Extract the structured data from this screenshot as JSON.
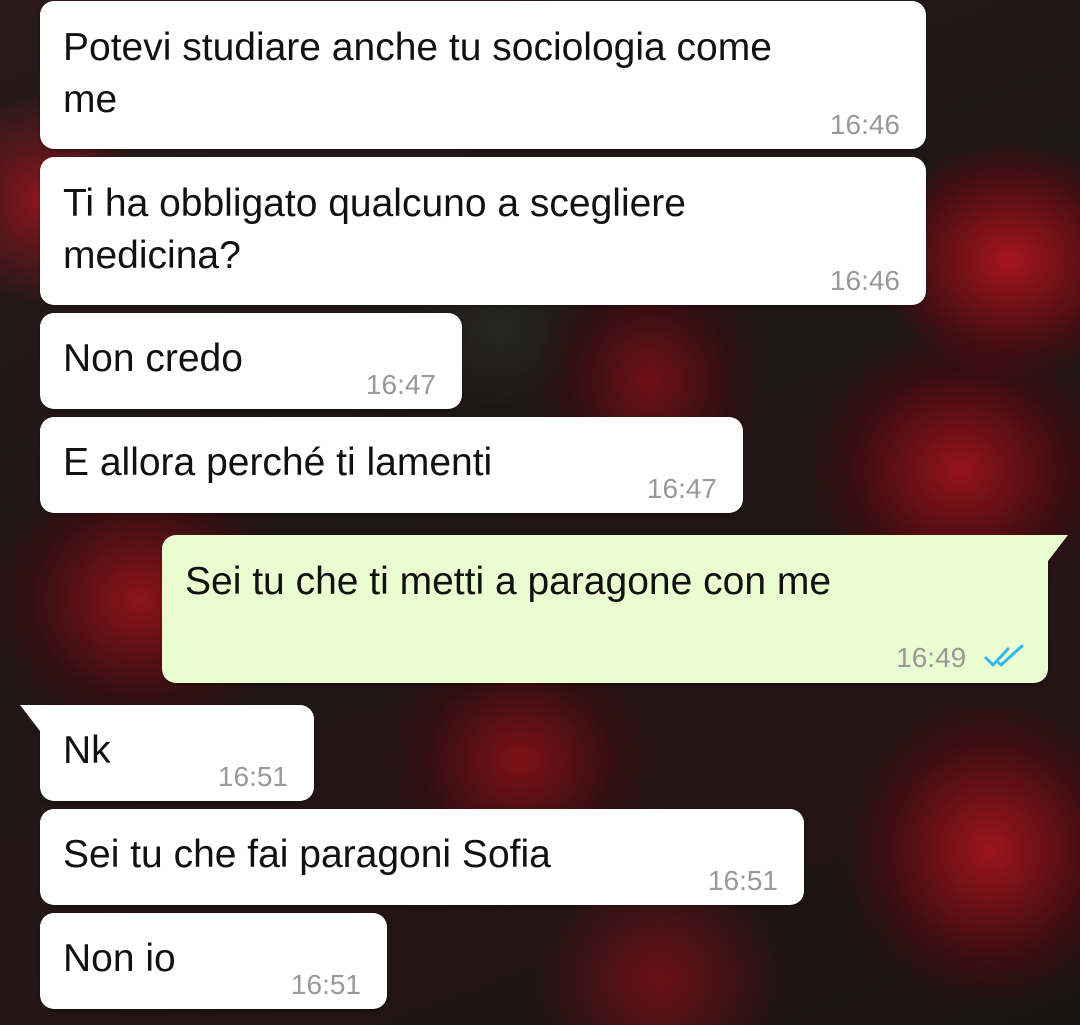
{
  "messages": [
    {
      "text_line1": "Potevi studiare anche tu sociologia come",
      "text_line2": "me",
      "time": "16:46"
    },
    {
      "text_line1": "Ti ha obbligato qualcuno a scegliere",
      "text_line2": "medicina?",
      "time": "16:46"
    },
    {
      "text": "Non credo",
      "time": "16:47"
    },
    {
      "text": "E allora perché ti lamenti",
      "time": "16:47"
    },
    {
      "text": "Sei tu che ti metti a paragone con me",
      "time": "16:49",
      "status_icon": "double-check-icon",
      "status_color": "#34b7f1"
    },
    {
      "text": "Nk",
      "time": "16:51"
    },
    {
      "text": "Sei tu che fai paragoni Sofia",
      "time": "16:51"
    },
    {
      "text": "Non io",
      "time": "16:51"
    }
  ],
  "colors": {
    "incoming_bubble": "#ffffff",
    "outgoing_bubble": "#e9fdd1",
    "timestamp": "#999999",
    "read_ticks": "#34b7f1"
  }
}
